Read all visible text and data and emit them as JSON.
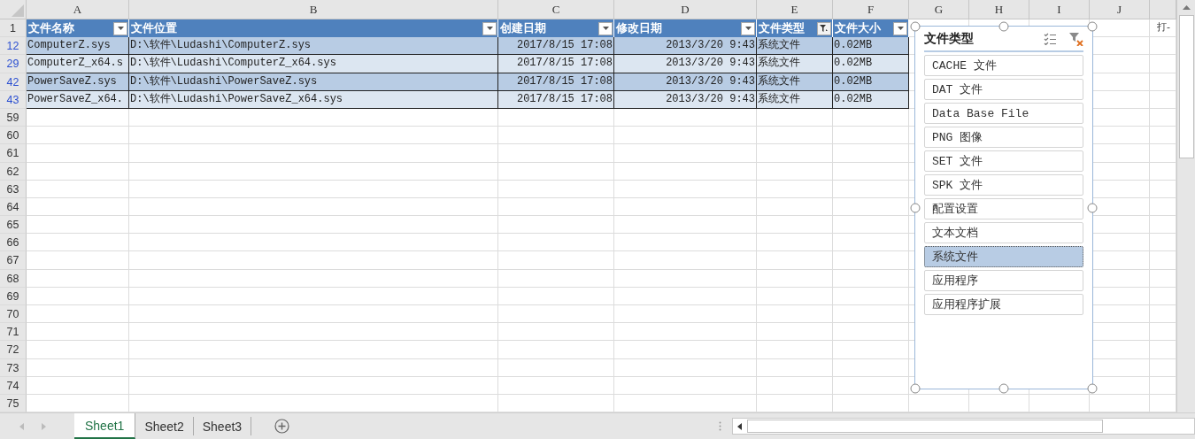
{
  "column_letters": [
    "A",
    "B",
    "C",
    "D",
    "E",
    "F",
    "G",
    "H",
    "I",
    "J"
  ],
  "table": {
    "header_row_number": "1",
    "columns": [
      {
        "label": "文件名称",
        "filtered": false,
        "kind": "text"
      },
      {
        "label": "文件位置",
        "filtered": false,
        "kind": "text"
      },
      {
        "label": "创建日期",
        "filtered": false,
        "kind": "date"
      },
      {
        "label": "修改日期",
        "filtered": false,
        "kind": "date"
      },
      {
        "label": "文件类型",
        "filtered": true,
        "kind": "text"
      },
      {
        "label": "文件大小",
        "filtered": false,
        "kind": "text"
      }
    ],
    "rows": [
      {
        "row_number": "12",
        "cells": [
          "ComputerZ.sys",
          "D:\\软件\\Ludashi\\ComputerZ.sys",
          "2017/8/15 17:08",
          "2013/3/20 9:43",
          "系统文件",
          "0.02MB"
        ]
      },
      {
        "row_number": "29",
        "cells": [
          "ComputerZ_x64.s",
          "D:\\软件\\Ludashi\\ComputerZ_x64.sys",
          "2017/8/15 17:08",
          "2013/3/20 9:43",
          "系统文件",
          "0.02MB"
        ]
      },
      {
        "row_number": "42",
        "cells": [
          "PowerSaveZ.sys",
          "D:\\软件\\Ludashi\\PowerSaveZ.sys",
          "2017/8/15 17:08",
          "2013/3/20 9:43",
          "系统文件",
          "0.02MB"
        ]
      },
      {
        "row_number": "43",
        "cells": [
          "PowerSaveZ_x64.",
          "D:\\软件\\Ludashi\\PowerSaveZ_x64.sys",
          "2017/8/15 17:08",
          "2013/3/20 9:43",
          "系统文件",
          "0.02MB"
        ]
      }
    ]
  },
  "empty_rows": [
    "59",
    "60",
    "61",
    "62",
    "63",
    "64",
    "65",
    "66",
    "67",
    "68",
    "69",
    "70",
    "71",
    "72",
    "73",
    "74",
    "75"
  ],
  "cut_shape_text": "打-",
  "slicer": {
    "title": "文件类型",
    "items": [
      {
        "label": "CACHE 文件",
        "selected": false
      },
      {
        "label": "DAT 文件",
        "selected": false
      },
      {
        "label": "Data Base File",
        "selected": false
      },
      {
        "label": "PNG 图像",
        "selected": false
      },
      {
        "label": "SET 文件",
        "selected": false
      },
      {
        "label": "SPK 文件",
        "selected": false
      },
      {
        "label": "配置设置",
        "selected": false
      },
      {
        "label": "文本文档",
        "selected": false
      },
      {
        "label": "系统文件",
        "selected": true
      },
      {
        "label": "应用程序",
        "selected": false
      },
      {
        "label": "应用程序扩展",
        "selected": false
      }
    ]
  },
  "sheet_tabs": [
    {
      "label": "Sheet1",
      "selected": true
    },
    {
      "label": "Sheet2",
      "selected": false
    },
    {
      "label": "Sheet3",
      "selected": false
    }
  ]
}
